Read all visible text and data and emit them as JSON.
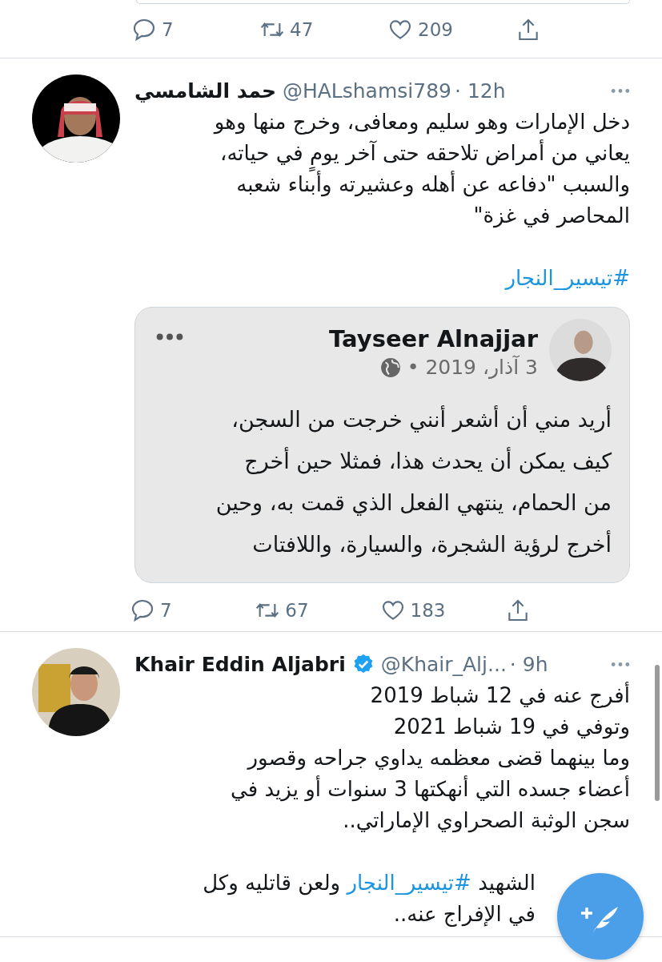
{
  "tweets": [
    {
      "kind": "actions_only",
      "actions": {
        "replies": "7",
        "retweets": "47",
        "likes": "209"
      }
    },
    {
      "kind": "tweet",
      "name": "حمد الشامسي",
      "verified": false,
      "handle": "@HALshamsi789",
      "time": "· 12h",
      "paragraphs": [
        [
          [
            {
              "kind": "text",
              "text": "دخل الإمارات وهو سليم ومعافى، وخرج منها وهو"
            }
          ],
          [
            {
              "kind": "text",
              "text": "يعاني من أمراض تلاحقه حتى آخر يومٍ في حياته،"
            }
          ],
          [
            {
              "kind": "text",
              "text": "والسبب \"دفاعه عن أهله وعشيرته وأبناء شعبه"
            }
          ],
          [
            {
              "kind": "text",
              "text": "المحاصر في غزة\""
            }
          ]
        ],
        [
          [
            {
              "kind": "hashtag",
              "text": "#تيسير_النجار"
            }
          ]
        ]
      ],
      "quote": {
        "name": "Tayseer Alnajjar",
        "date": "3 آذار، 2019 •",
        "lines": [
          "أريد مني أن أشعر أنني خرجت من السجن،",
          "كيف يمكن أن يحدث هذا،  فمثلا حين أخرج",
          "من الحمام، ينتهي الفعل الذي قمت به، وحين",
          "أخرج لرؤية الشجرة، والسيارة، واللافتات"
        ]
      },
      "actions": {
        "replies": "7",
        "retweets": "67",
        "likes": "183"
      }
    },
    {
      "kind": "tweet",
      "name": "Khair Eddin Aljabri",
      "verified": true,
      "handle": "@Khair_Alj...",
      "time": "· 9h",
      "paragraphs": [
        [
          [
            {
              "kind": "text",
              "text": "أفرج عنه في 12 شباط 2019"
            }
          ],
          [
            {
              "kind": "text",
              "text": "وتوفي في 19 شباط 2021"
            }
          ],
          [
            {
              "kind": "text",
              "text": "وما بينهما قضى معظمه يداوي جراحه وقصور"
            }
          ],
          [
            {
              "kind": "text",
              "text": "أعضاء جسده التي أنهكتها 3 سنوات أو يزيد في"
            }
          ],
          [
            {
              "kind": "text",
              "text": "سجن الوثبة الصحراوي الإماراتي.."
            }
          ]
        ],
        [
          [
            {
              "kind": "text",
              "text": "الشهيد "
            },
            {
              "kind": "hashtag",
              "text": "#تيسير_النجار"
            },
            {
              "kind": "text",
              "text": " ولعن قاتليه وكل"
            }
          ],
          [
            {
              "kind": "text",
              "text": "في الإفراج عنه.."
            }
          ]
        ]
      ]
    }
  ]
}
